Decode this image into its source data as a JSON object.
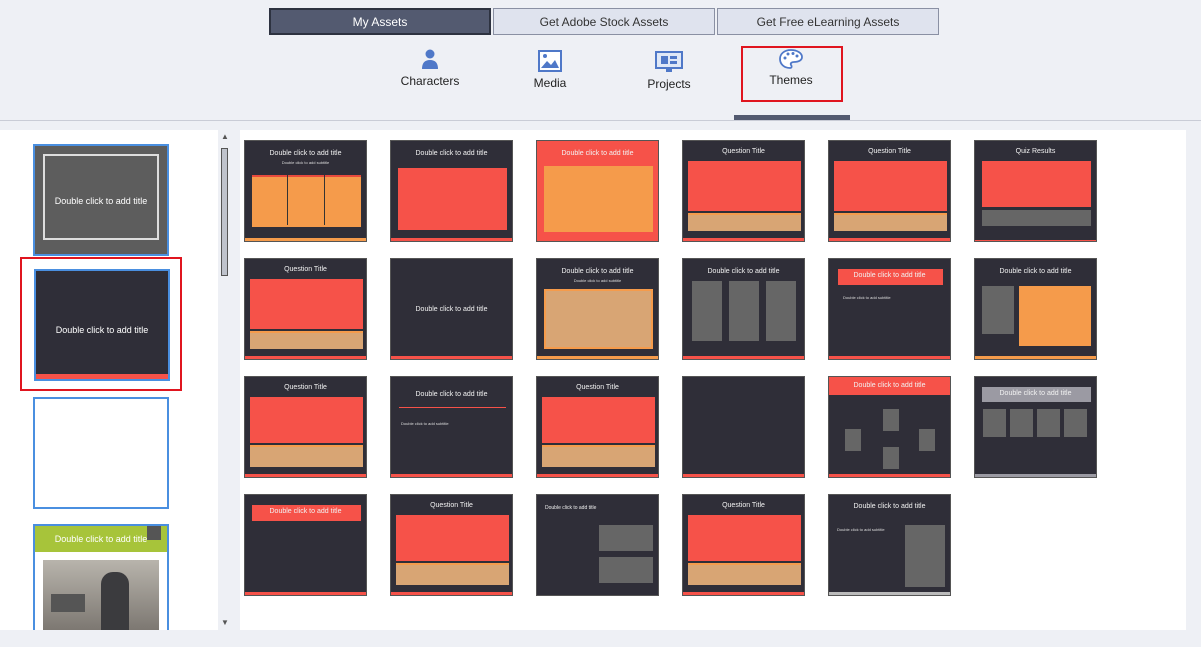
{
  "top_tabs": [
    "My Assets",
    "Get Adobe Stock Assets",
    "Get Free eLearning Assets"
  ],
  "categories": {
    "characters": "Characters",
    "media": "Media",
    "projects": "Projects",
    "themes": "Themes"
  },
  "left_thumbs": {
    "t1": "Double click to add title",
    "t2": "Double click to add title",
    "t4": "Double click to add title"
  },
  "grid": {
    "r1": [
      "Double click to add title",
      "Double click to add title",
      "Double click to add title",
      "Question Title",
      "Question Title",
      "Quiz Results"
    ],
    "r1_sub": "Double click to add subtitle",
    "r2": [
      "Question Title",
      "Double click to add title",
      "Double click to add title",
      "Double click to add title",
      "Double click to add title",
      "Double click to add title"
    ],
    "r2_sub": "Double click to add subtitle",
    "r3": [
      "Question Title",
      "Double click to add title",
      "Question Title",
      "",
      "Double click to add title",
      "Double click to add title"
    ],
    "r4": [
      "Double click to add title",
      "Question Title",
      "Double click to add title",
      "Question Title",
      "Double click to add title"
    ],
    "subtitle": "Double click to add subtitle",
    "question": "Question"
  },
  "colors": {
    "red": "#f65249",
    "orange": "#f59b4b",
    "tan": "#d8a574",
    "dark": "#2f2e38",
    "accent": "#e0151f"
  }
}
